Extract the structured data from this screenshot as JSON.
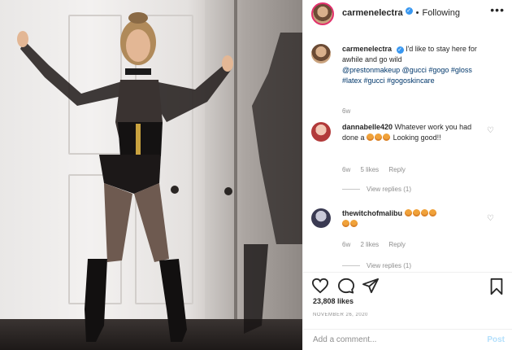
{
  "post": {
    "username": "carmenelectra",
    "follow_state": "Following",
    "separator": "•",
    "more_label": "•••"
  },
  "caption": {
    "username": "carmenelectra",
    "text": "I'd like to stay here for awhile and go wild",
    "tags": "@prestonmakeup @gucci #gogo #gloss #latex #gucci #gogoskincare",
    "time": "6w"
  },
  "comments": [
    {
      "username": "dannabelle420",
      "text": "Whatever work you had done a",
      "text_after": "Looking good!!",
      "emoji_count": 3,
      "time": "6w",
      "likes": "5 likes",
      "reply": "Reply",
      "view_replies": "View replies (1)"
    },
    {
      "username": "thewitchofmalibu",
      "text": "",
      "emoji_count": 6,
      "time": "6w",
      "likes": "2 likes",
      "reply": "Reply",
      "view_replies": "View replies (1)"
    }
  ],
  "stats": {
    "likes": "23,808 likes",
    "date": "NOVEMBER 26, 2020"
  },
  "add_comment": {
    "placeholder": "Add a comment...",
    "post_label": "Post"
  },
  "colors": {
    "accent": "#3897f0",
    "text": "#262626",
    "muted": "#8e8e8e",
    "post_disabled": "#b2dffc"
  }
}
